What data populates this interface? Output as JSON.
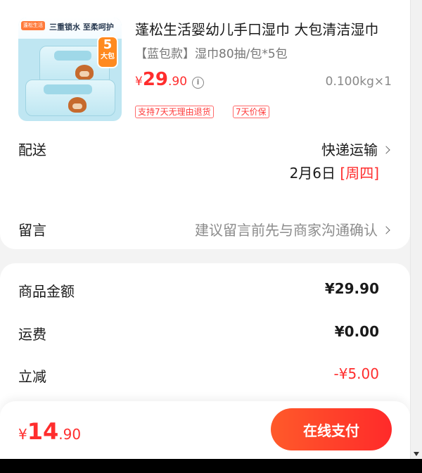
{
  "product": {
    "image_brand_tag": "蓬松生活",
    "image_slogan": "三重锁水 至柔呵护",
    "image_badge_number": "5",
    "image_badge_text": "大包",
    "title": "蓬松生活婴幼儿手口湿巾 大包清洁湿巾",
    "spec": "【蓝包款】湿巾80抽/包*5包",
    "price_symbol": "¥",
    "price_int": "29",
    "price_dec": ".90",
    "weight": "0.100kg×1",
    "tags": [
      "支持7天无理由退货",
      "7天价保"
    ]
  },
  "delivery": {
    "label": "配送",
    "method": "快递运输",
    "date": "2月6日",
    "weekday": "[周四]"
  },
  "message": {
    "label": "留言",
    "placeholder": "建议留言前先与商家沟通确认"
  },
  "summary": {
    "items_label": "商品金额",
    "items_value": "¥29.90",
    "shipping_label": "运费",
    "shipping_value": "¥0.00",
    "discount_label": "立减",
    "discount_value": "-¥5.00"
  },
  "checkout": {
    "total_symbol": "¥",
    "total_int": "14",
    "total_dec": ".90",
    "pay_label": "在线支付"
  },
  "colors": {
    "accent": "#ff2d2d",
    "pay_gradient_start": "#ff5a2a",
    "pay_gradient_end": "#ff2a2a"
  }
}
